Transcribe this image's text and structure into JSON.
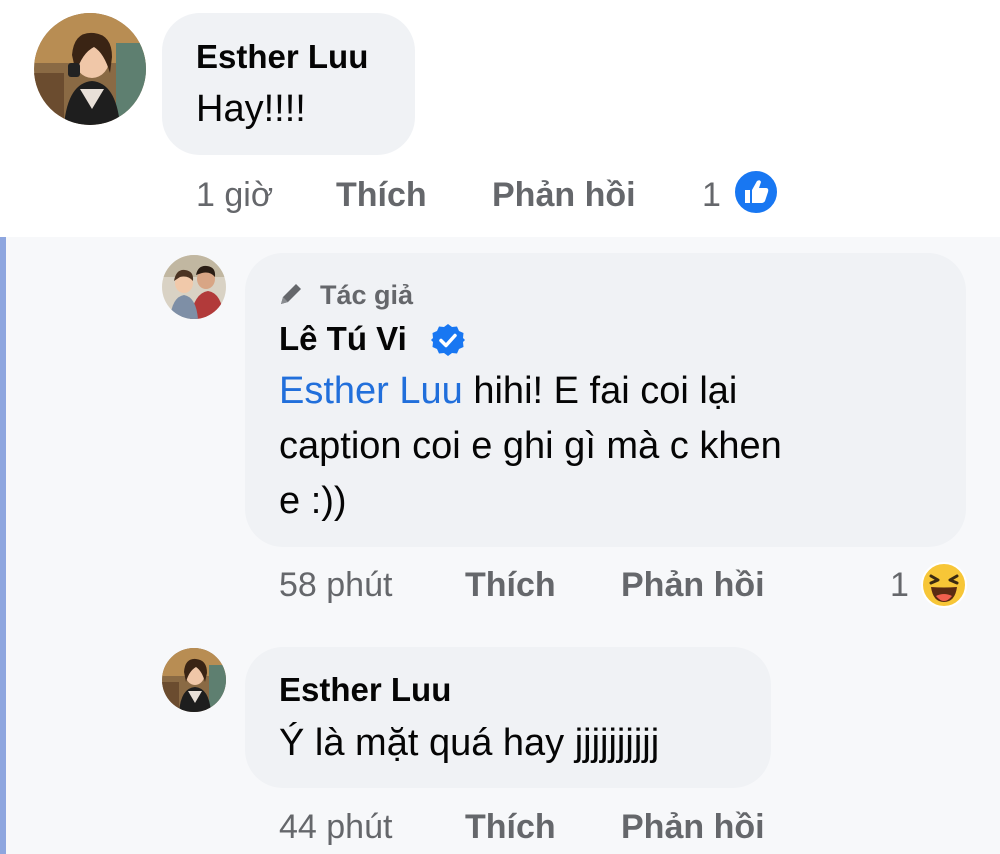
{
  "comment": {
    "name": "Esther Luu",
    "text": "Hay!!!!",
    "time": "1 giờ",
    "like_label": "Thích",
    "reply_label": "Phản hồi",
    "reaction_count": "1",
    "reaction_icon": "like-icon"
  },
  "replies": [
    {
      "author_badge": "Tác giả",
      "name": "Lê Tú Vi",
      "verified": true,
      "mention": "Esther Luu",
      "text_line1": " hihi! E fai coi lại",
      "text_line2": "caption coi e ghi gì mà c khen",
      "text_line3": "e :))",
      "time": "58 phút",
      "like_label": "Thích",
      "reply_label": "Phản hồi",
      "reaction_count": "1",
      "reaction_icon": "haha-icon"
    },
    {
      "name": "Esther Luu",
      "text": "Ý là mặt quá hay jjjjjjjjjj",
      "time": "44 phút",
      "like_label": "Thích",
      "reply_label": "Phản hồi"
    }
  ],
  "colors": {
    "accent_blue": "#1877f2",
    "mention_blue": "#216fdb",
    "secondary_text": "#65676b",
    "bubble_bg": "#f0f2f5"
  }
}
